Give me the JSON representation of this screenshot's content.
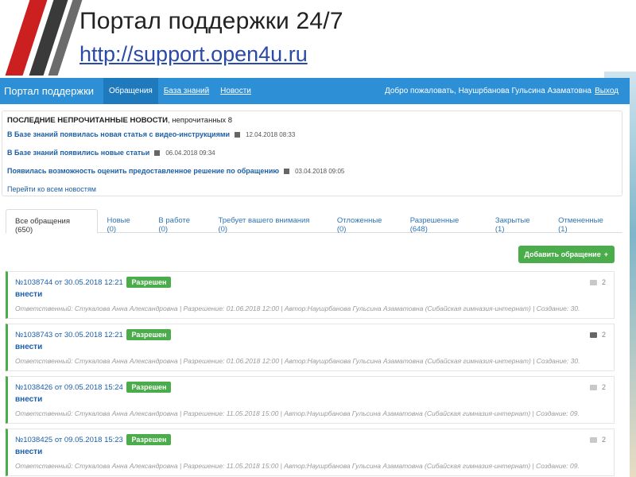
{
  "slide": {
    "title": "Портал поддержки 24/7",
    "link": "http://support.open4u.ru"
  },
  "topbar": {
    "brand": "Портал поддержки",
    "nav": [
      {
        "label": "Обращения"
      },
      {
        "label": "База знаний"
      },
      {
        "label": "Новости"
      }
    ],
    "welcome": "Добро пожаловать, Наушрбанова Гульсина Азаматовна",
    "logout": "Выход"
  },
  "news": {
    "heading": "ПОСЛЕДНИЕ НЕПРОЧИТАННЫЕ НОВОСТИ",
    "unread": ", непрочитанных 8",
    "items": [
      {
        "title": "В Базе знаний появилась новая статья с видео-инструкциями",
        "date": "12.04.2018 08:33"
      },
      {
        "title": "В Базе знаний появились новые статьи",
        "date": "06.04.2018 09:34"
      },
      {
        "title": "Появилась возможность оценить предоставленное решение по обращению",
        "date": "03.04.2018 09:05"
      }
    ],
    "all_link": "Перейти ко всем новостям"
  },
  "tabs": [
    {
      "label": "Все обращения (650)"
    },
    {
      "label": "Новые (0)"
    },
    {
      "label": "В работе (0)"
    },
    {
      "label": "Требует вашего внимания (0)"
    },
    {
      "label": "Отложенные (0)"
    },
    {
      "label": "Разрешенные (648)"
    },
    {
      "label": "Закрытые (1)"
    },
    {
      "label": "Отмененные (1)"
    }
  ],
  "add_button": "Добавить обращение",
  "tickets": [
    {
      "head": "№1038744 от 30.05.2018 12:21",
      "status": "Разрешен",
      "title": "внести",
      "meta": "Ответственный: Стукалова Анна Александровна | Разрешение: 01.06.2018 12:00 | Автор:Наушрбанова Гульсина Азаматовна (Сибайская гимназия-интернат) | Создание: 30.",
      "comments": "2"
    },
    {
      "head": "№1038743 от 30.05.2018 12:21",
      "status": "Разрешен",
      "title": "внести",
      "meta": "Ответственный: Стукалова Анна Александровна | Разрешение: 01.06.2018 12:00 | Автор:Наушрбанова Гульсина Азаматовна (Сибайская гимназия-интернат) | Создание: 30.",
      "comments": "2"
    },
    {
      "head": "№1038426 от 09.05.2018 15:24",
      "status": "Разрешен",
      "title": "внести",
      "meta": "Ответственный: Стукалова Анна Александровна | Разрешение: 11.05.2018 15:00 | Автор:Наушрбанова Гульсина Азаматовна (Сибайская гимназия-интернат) | Создание: 09.",
      "comments": "2"
    },
    {
      "head": "№1038425 от 09.05.2018 15:23",
      "status": "Разрешен",
      "title": "внести",
      "meta": "Ответственный: Стукалова Анна Александровна | Разрешение: 11.05.2018 15:00 | Автор:Наушрбанова Гульсина Азаматовна (Сибайская гимназия-интернат) | Создание: 09.",
      "comments": "2"
    }
  ]
}
